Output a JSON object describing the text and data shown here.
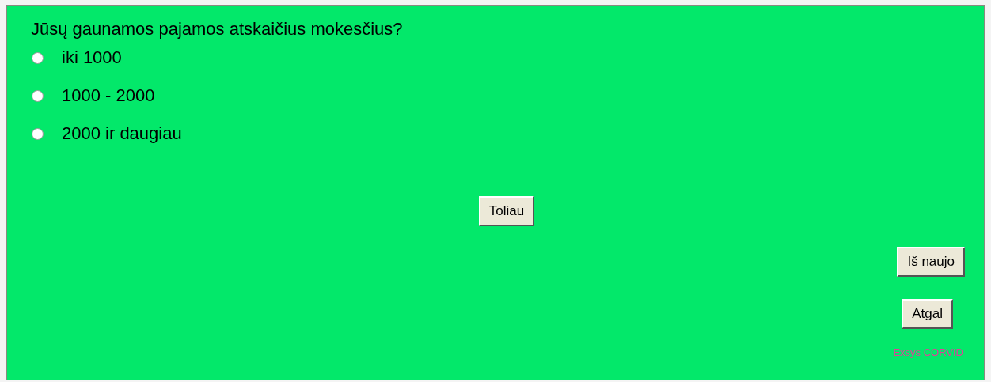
{
  "question": "Jūsų gaunamos pajamos atskaičius mokesčius?",
  "options": [
    {
      "label": "iki 1000",
      "selected": false
    },
    {
      "label": "1000 - 2000",
      "selected": false
    },
    {
      "label": "2000 ir daugiau",
      "selected": false
    }
  ],
  "next_button": "Toliau",
  "restart_button": "Iš naujo",
  "back_button": "Atgal",
  "footer": "Exsys CORVID"
}
